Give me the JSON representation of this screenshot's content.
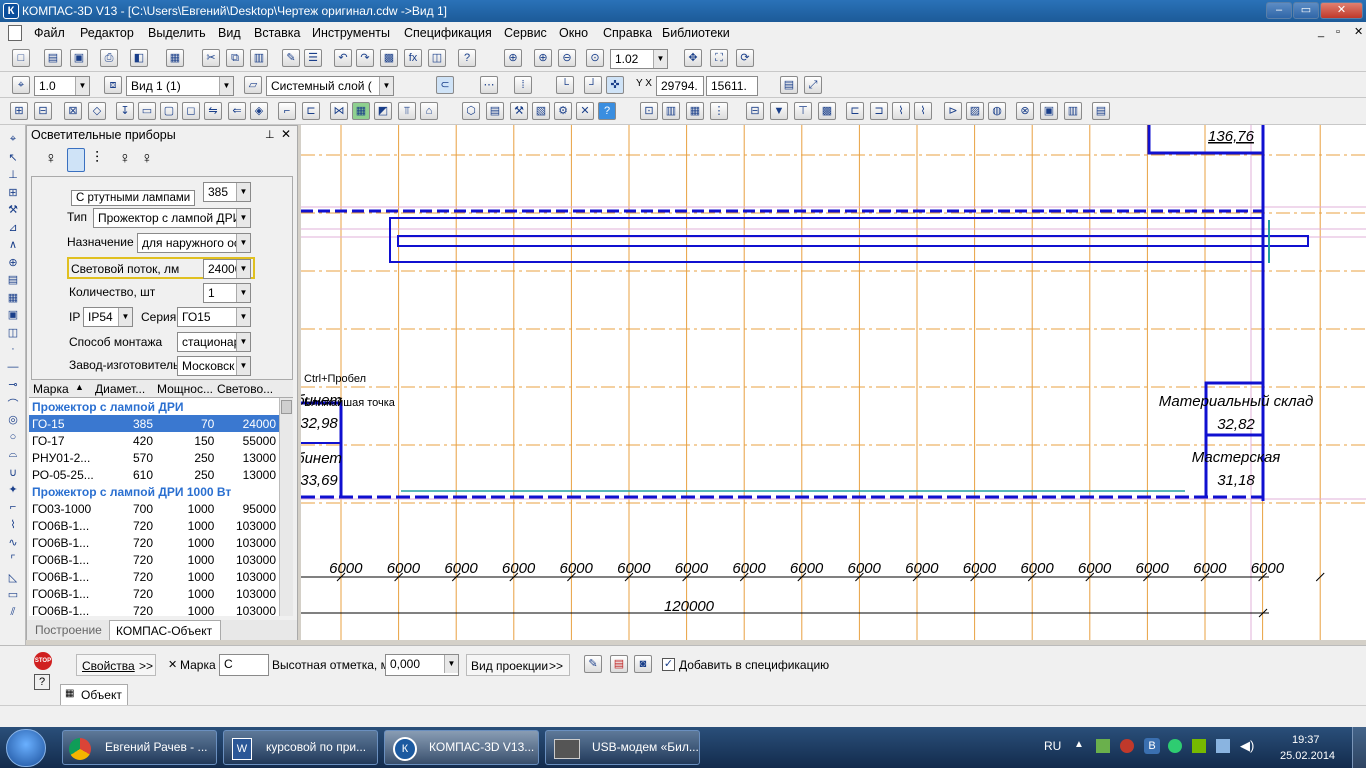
{
  "window": {
    "title": "КОМПАС-3D V13 - [C:\\Users\\Евгений\\Desktop\\Чертеж оригинал.cdw ->Вид 1]",
    "app_icon": "К"
  },
  "menu": [
    "Файл",
    "Редактор",
    "Выделить",
    "Вид",
    "Вставка",
    "Инструменты",
    "Спецификация",
    "Сервис",
    "Окно",
    "Справка",
    "Библиотеки"
  ],
  "toolbar1": {
    "zoom": "1.02"
  },
  "toolbar2": {
    "scale": "1.0",
    "view": "Вид 1 (1)",
    "layer": "Системный слой (",
    "coord_x": "29794.",
    "coord_y": "15611."
  },
  "panel": {
    "title": "Осветительные приборы",
    "tooltip": "С ртутными лампами",
    "fields": {
      "power_value": "385",
      "type_label": "Тип",
      "type_value": "Прожектор с лампой ДРИ",
      "purpose_label": "Назначение",
      "purpose_value": "для наружного ос",
      "flux_label": "Световой поток, лм",
      "flux_value": "24000",
      "count_label": "Количество, шт",
      "count_value": "1",
      "ip_label": "IP",
      "ip_value": "IP54",
      "series_label": "Серия",
      "series_value": "ГО15",
      "mount_label": "Способ монтажа",
      "mount_value": "стационар",
      "maker_label": "Завод-изготовитель",
      "maker_value": "Московск"
    },
    "columns": [
      "Марка",
      "Диамет...",
      "Мощнос...",
      "Светово..."
    ],
    "groups": [
      {
        "name": "Прожектор с лампой ДРИ",
        "rows": [
          [
            "ГО-15",
            "385",
            "70",
            "24000"
          ],
          [
            "ГО-17",
            "420",
            "150",
            "55000"
          ],
          [
            "РНУ01-2...",
            "570",
            "250",
            "13000"
          ],
          [
            "РО-05-25...",
            "610",
            "250",
            "13000"
          ]
        ]
      },
      {
        "name": "Прожектор с лампой ДРИ 1000 Вт",
        "rows": [
          [
            "ГО03-1000",
            "700",
            "1000",
            "95000"
          ],
          [
            "ГО06В-1...",
            "720",
            "1000",
            "103000"
          ],
          [
            "ГО06В-1...",
            "720",
            "1000",
            "103000"
          ],
          [
            "ГО06В-1...",
            "720",
            "1000",
            "103000"
          ],
          [
            "ГО06В-1...",
            "720",
            "1000",
            "103000"
          ],
          [
            "ГО06В-1...",
            "720",
            "1000",
            "103000"
          ],
          [
            "ГО06В-1...",
            "720",
            "1000",
            "103000"
          ]
        ]
      }
    ],
    "tabs": [
      "Построение",
      "КОМПАС-Объект"
    ]
  },
  "canvas": {
    "hint1": "Ctrl+Пробел",
    "hint2": "Ближайшая точка",
    "room_top": "136,76",
    "left_rooms": [
      {
        "name": "бинет",
        "area": "32,98"
      },
      {
        "name": "бинет",
        "area": "33,69"
      }
    ],
    "right_rooms": [
      {
        "name": "Материальный склад",
        "area": "32,82"
      },
      {
        "name": "Мастерская",
        "area": "31,18"
      }
    ],
    "dims": [
      "6000",
      "6000",
      "6000",
      "6000",
      "6000",
      "6000",
      "6000",
      "6000",
      "6000",
      "6000",
      "6000",
      "6000",
      "6000",
      "6000",
      "6000",
      "6000",
      "6000"
    ],
    "total": "120000"
  },
  "bottom": {
    "props": "Свойства",
    "props_arrow": ">>",
    "mark_label": "Марка",
    "mark_value": "С",
    "height_label": "Высотная отметка, м",
    "height_value": "0,000",
    "proj_label": "Вид проекции",
    "proj_arrow": ">>",
    "spec_label": "Добавить в спецификацию",
    "tab": "Объект",
    "stop": "STOP"
  },
  "taskbar": {
    "items": [
      "Евгений Рачев - ...",
      "курсовой по при...",
      "КОМПАС-3D V13...",
      "USB-модем «Бил..."
    ],
    "lang": "RU",
    "time": "19:37",
    "date": "25.02.2014"
  }
}
